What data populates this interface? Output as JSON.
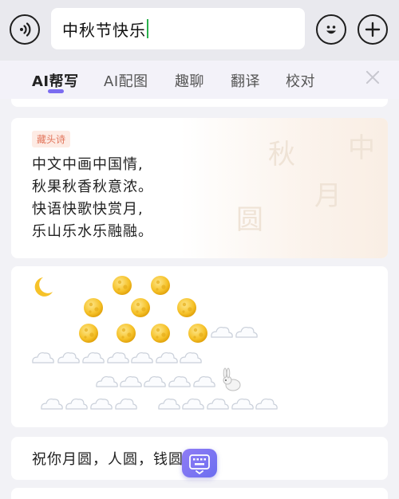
{
  "input": {
    "value": "中秋节快乐"
  },
  "tabs": [
    {
      "label": "AI帮写",
      "active": true
    },
    {
      "label": "AI配图",
      "active": false
    },
    {
      "label": "趣聊",
      "active": false
    },
    {
      "label": "翻译",
      "active": false
    },
    {
      "label": "校对",
      "active": false
    }
  ],
  "poem": {
    "tag": "藏头诗",
    "lines": [
      "中文中画中国情,",
      "秋果秋香秋意浓。",
      "快语快歌快赏月,",
      "乐山乐水乐融融。"
    ]
  },
  "emoji_art": {
    "rows": [
      "🌙 🌕🌕",
      "🌕🌕🌕",
      "🌕🌕🌕🌕☁☁",
      "☁☁☁☁☁☁☁",
      "☁☁☁☁☁🐇",
      "☁☁☁☁ ☁☁☁☁☁"
    ]
  },
  "wish": {
    "text": "祝你月圆，人圆，钱圆💰"
  },
  "icons": [
    "voice-icon",
    "emoji-icon",
    "plus-icon",
    "close-icon",
    "keyboard-icon",
    "moon-icon",
    "full-moon-icon",
    "cloud-icon",
    "rabbit-icon",
    "money-bag-icon"
  ],
  "colors": {
    "accent": "#7b6cf0",
    "tag_text": "#e2765c",
    "tag_bg": "#fdebe4",
    "caret": "#2ab24e",
    "moon": "#f7c52a"
  }
}
